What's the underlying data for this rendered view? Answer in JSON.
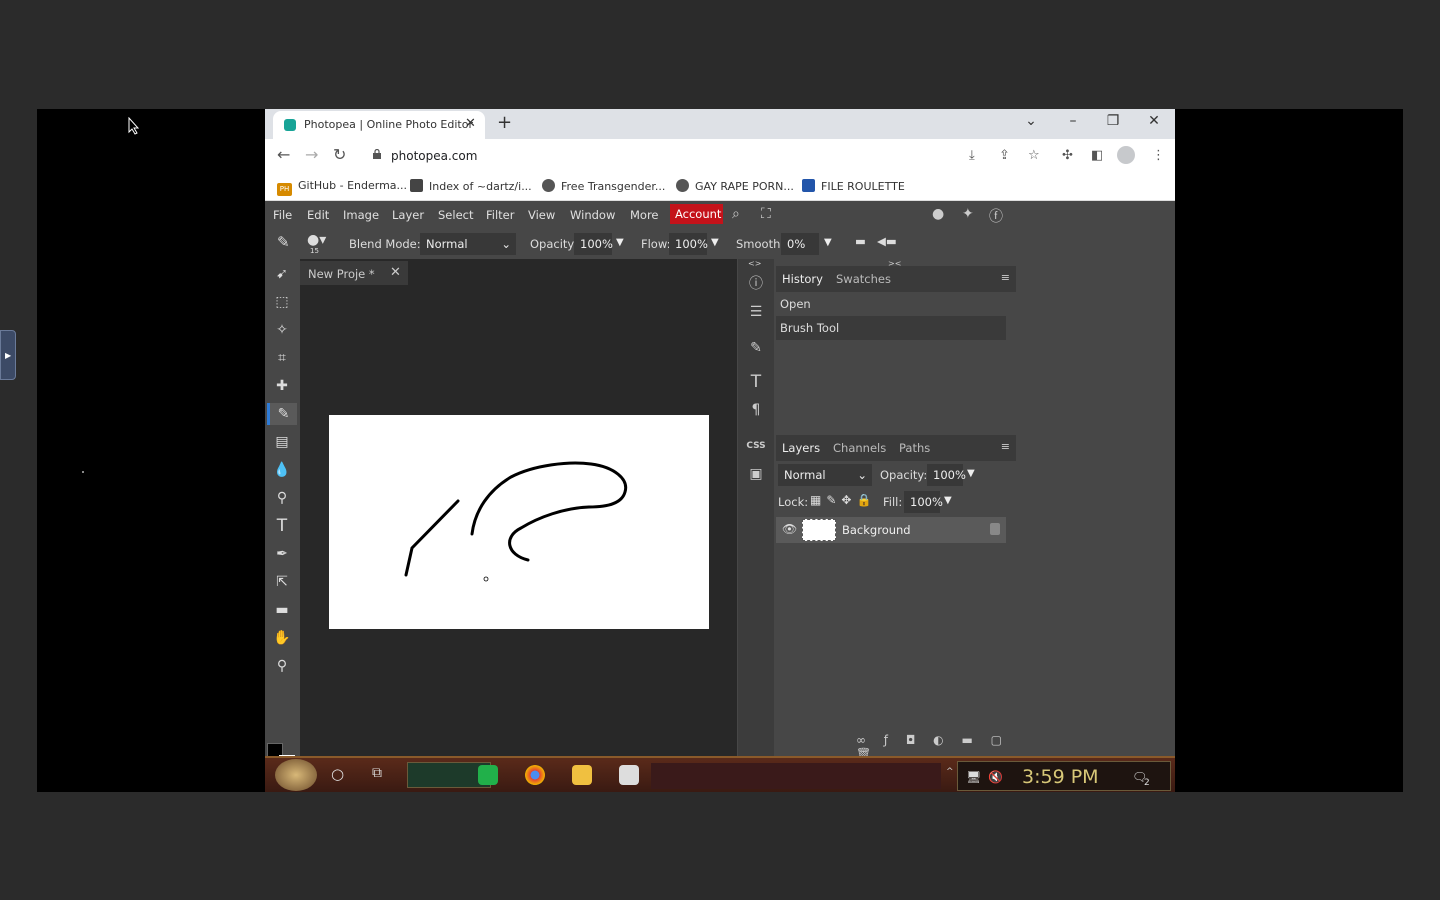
{
  "browser": {
    "tab_title": "Photopea | Online Photo Editor",
    "url": "photopea.com",
    "bookmarks": [
      {
        "label": "GitHub - Enderma...",
        "color": "#d68a00"
      },
      {
        "label": "Index of ~dartz/i...",
        "color": "#444444"
      },
      {
        "label": "Free Transgender...",
        "color": "#555555"
      },
      {
        "label": "GAY RAPE PORN...",
        "color": "#555555"
      },
      {
        "label": "FILE ROULETTE",
        "color": "#2255aa"
      }
    ],
    "bookmark_badge": "PH"
  },
  "app": {
    "menu": [
      "File",
      "Edit",
      "Image",
      "Layer",
      "Select",
      "Filter",
      "View",
      "Window",
      "More"
    ],
    "account_label": "Account",
    "options": {
      "blend_label": "Blend Mode:",
      "blend_value": "Normal",
      "opacity_label": "Opacity:",
      "opacity_value": "100%",
      "flow_label": "Flow:",
      "flow_value": "100%",
      "smooth_label": "Smooth:",
      "smooth_value": "0%",
      "brush_size": "15"
    },
    "document_tab": "New Proje  *",
    "history": {
      "tabs": [
        "History",
        "Swatches"
      ],
      "items": [
        "Open",
        "Brush Tool"
      ]
    },
    "layers": {
      "tabs": [
        "Layers",
        "Channels",
        "Paths"
      ],
      "blend": "Normal",
      "opacity_label": "Opacity:",
      "opacity_value": "100%",
      "lock_label": "Lock:",
      "fill_label": "Fill:",
      "fill_value": "100%",
      "items": [
        {
          "name": "Background"
        }
      ]
    },
    "side_icons": {
      "css": "CSS"
    },
    "accent": "#c4121a"
  },
  "taskbar": {
    "time": "3:59 PM",
    "notif_count": "2"
  }
}
